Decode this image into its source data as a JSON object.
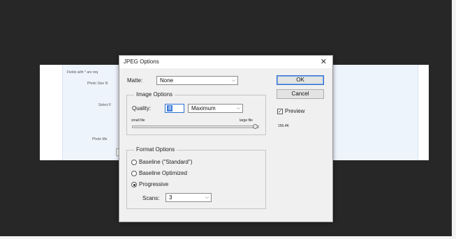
{
  "background_form": {
    "labels": [
      "Fields with * are req",
      "Photo Size N",
      "Select F",
      "T",
      "Photo Me"
    ]
  },
  "dialog": {
    "title": "JPEG Options",
    "close_glyph": "✕",
    "matte": {
      "label": "Matte:",
      "value": "None"
    },
    "buttons": {
      "ok": "OK",
      "cancel": "Cancel"
    },
    "preview": {
      "label": "Preview",
      "checked": true
    },
    "file_size": "156.4K",
    "image_options": {
      "title": "Image Options",
      "quality_label": "Quality:",
      "quality_value": "8",
      "quality_preset": "Maximum",
      "slider_min_label": "small file",
      "slider_max_label": "large file",
      "slider_value": 0.97
    },
    "format_options": {
      "title": "Format Options",
      "options": [
        "Baseline (\"Standard\")",
        "Baseline Optimized",
        "Progressive"
      ],
      "selected_index": 2,
      "scans_label": "Scans:",
      "scans_value": "3"
    }
  },
  "colors": {
    "desktop_bg": "#272727",
    "dialog_bg": "#f0f0f0",
    "accent": "#2f6fcf",
    "form_panel": "#eef4fc"
  }
}
